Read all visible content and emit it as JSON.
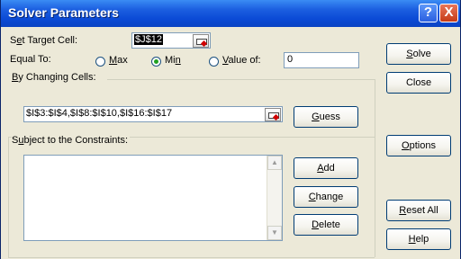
{
  "window": {
    "title": "Solver Parameters",
    "help_glyph": "?",
    "close_glyph": "X"
  },
  "target": {
    "label_prefix": "S",
    "label_key": "e",
    "label_suffix": "t Target Cell:",
    "value": "$J$12"
  },
  "equal_to": {
    "label": "Equal To:",
    "options": [
      {
        "pre": "",
        "key": "M",
        "post": "ax",
        "selected": false
      },
      {
        "pre": "Mi",
        "key": "n",
        "post": "",
        "selected": true
      },
      {
        "pre": "",
        "key": "V",
        "post": "alue of:",
        "selected": false
      }
    ],
    "value_of": "0"
  },
  "changing": {
    "label_prefix": "",
    "label_key": "B",
    "label_suffix": "y Changing Cells:",
    "value": "$I$3:$I$4,$I$8:$I$10,$I$16:$I$17"
  },
  "constraints": {
    "label_prefix": "S",
    "label_key": "u",
    "label_suffix": "bject to the Constraints:",
    "scroll_up": "▲",
    "scroll_down": "▼"
  },
  "buttons": {
    "solve": {
      "pre": "",
      "key": "S",
      "post": "olve"
    },
    "close": {
      "label": "Close"
    },
    "guess": {
      "pre": "",
      "key": "G",
      "post": "uess"
    },
    "options": {
      "pre": "",
      "key": "O",
      "post": "ptions"
    },
    "add": {
      "pre": "",
      "key": "A",
      "post": "dd"
    },
    "change": {
      "pre": "",
      "key": "C",
      "post": "hange"
    },
    "delete": {
      "pre": "",
      "key": "D",
      "post": "elete"
    },
    "reset_all": {
      "pre": "",
      "key": "R",
      "post": "eset All"
    },
    "help": {
      "pre": "",
      "key": "H",
      "post": "elp"
    }
  },
  "colors": {
    "titlebar": "#0b4ad6",
    "dialog": "#ece9d8",
    "selected_text_bg": "#000000"
  }
}
